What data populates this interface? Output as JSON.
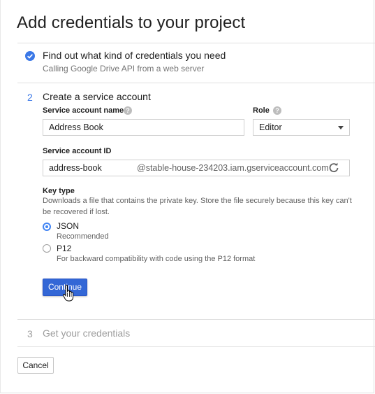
{
  "title": "Add credentials to your project",
  "step1": {
    "title": "Find out what kind of credentials you need",
    "subtitle": "Calling Google Drive API from a web server"
  },
  "step2": {
    "number": "2",
    "title": "Create a service account",
    "service_account_name": {
      "label": "Service account name",
      "value": "Address Book"
    },
    "role": {
      "label": "Role",
      "value": "Editor"
    },
    "service_account_id": {
      "label": "Service account ID",
      "value": "address-book",
      "suffix": "@stable-house-234203.iam.gserviceaccount.com"
    },
    "key_type": {
      "label": "Key type",
      "description_line1": "Downloads a file that contains the private key. Store the file securely because this key can't",
      "description_line2": "be recovered if lost.",
      "options": [
        {
          "label": "JSON",
          "sub": "Recommended",
          "selected": true
        },
        {
          "label": "P12",
          "sub": "For backward compatibility with code using the P12 format",
          "selected": false
        }
      ]
    },
    "continue_label": "Continue"
  },
  "step3": {
    "number": "3",
    "title": "Get your credentials"
  },
  "cancel_label": "Cancel",
  "colors": {
    "accent": "#4285f4",
    "button": "#3367d6",
    "muted": "#9e9e9e"
  },
  "icons": [
    "check-circle-icon",
    "help-icon",
    "dropdown-caret-icon",
    "refresh-icon",
    "pointer-hand-icon"
  ]
}
